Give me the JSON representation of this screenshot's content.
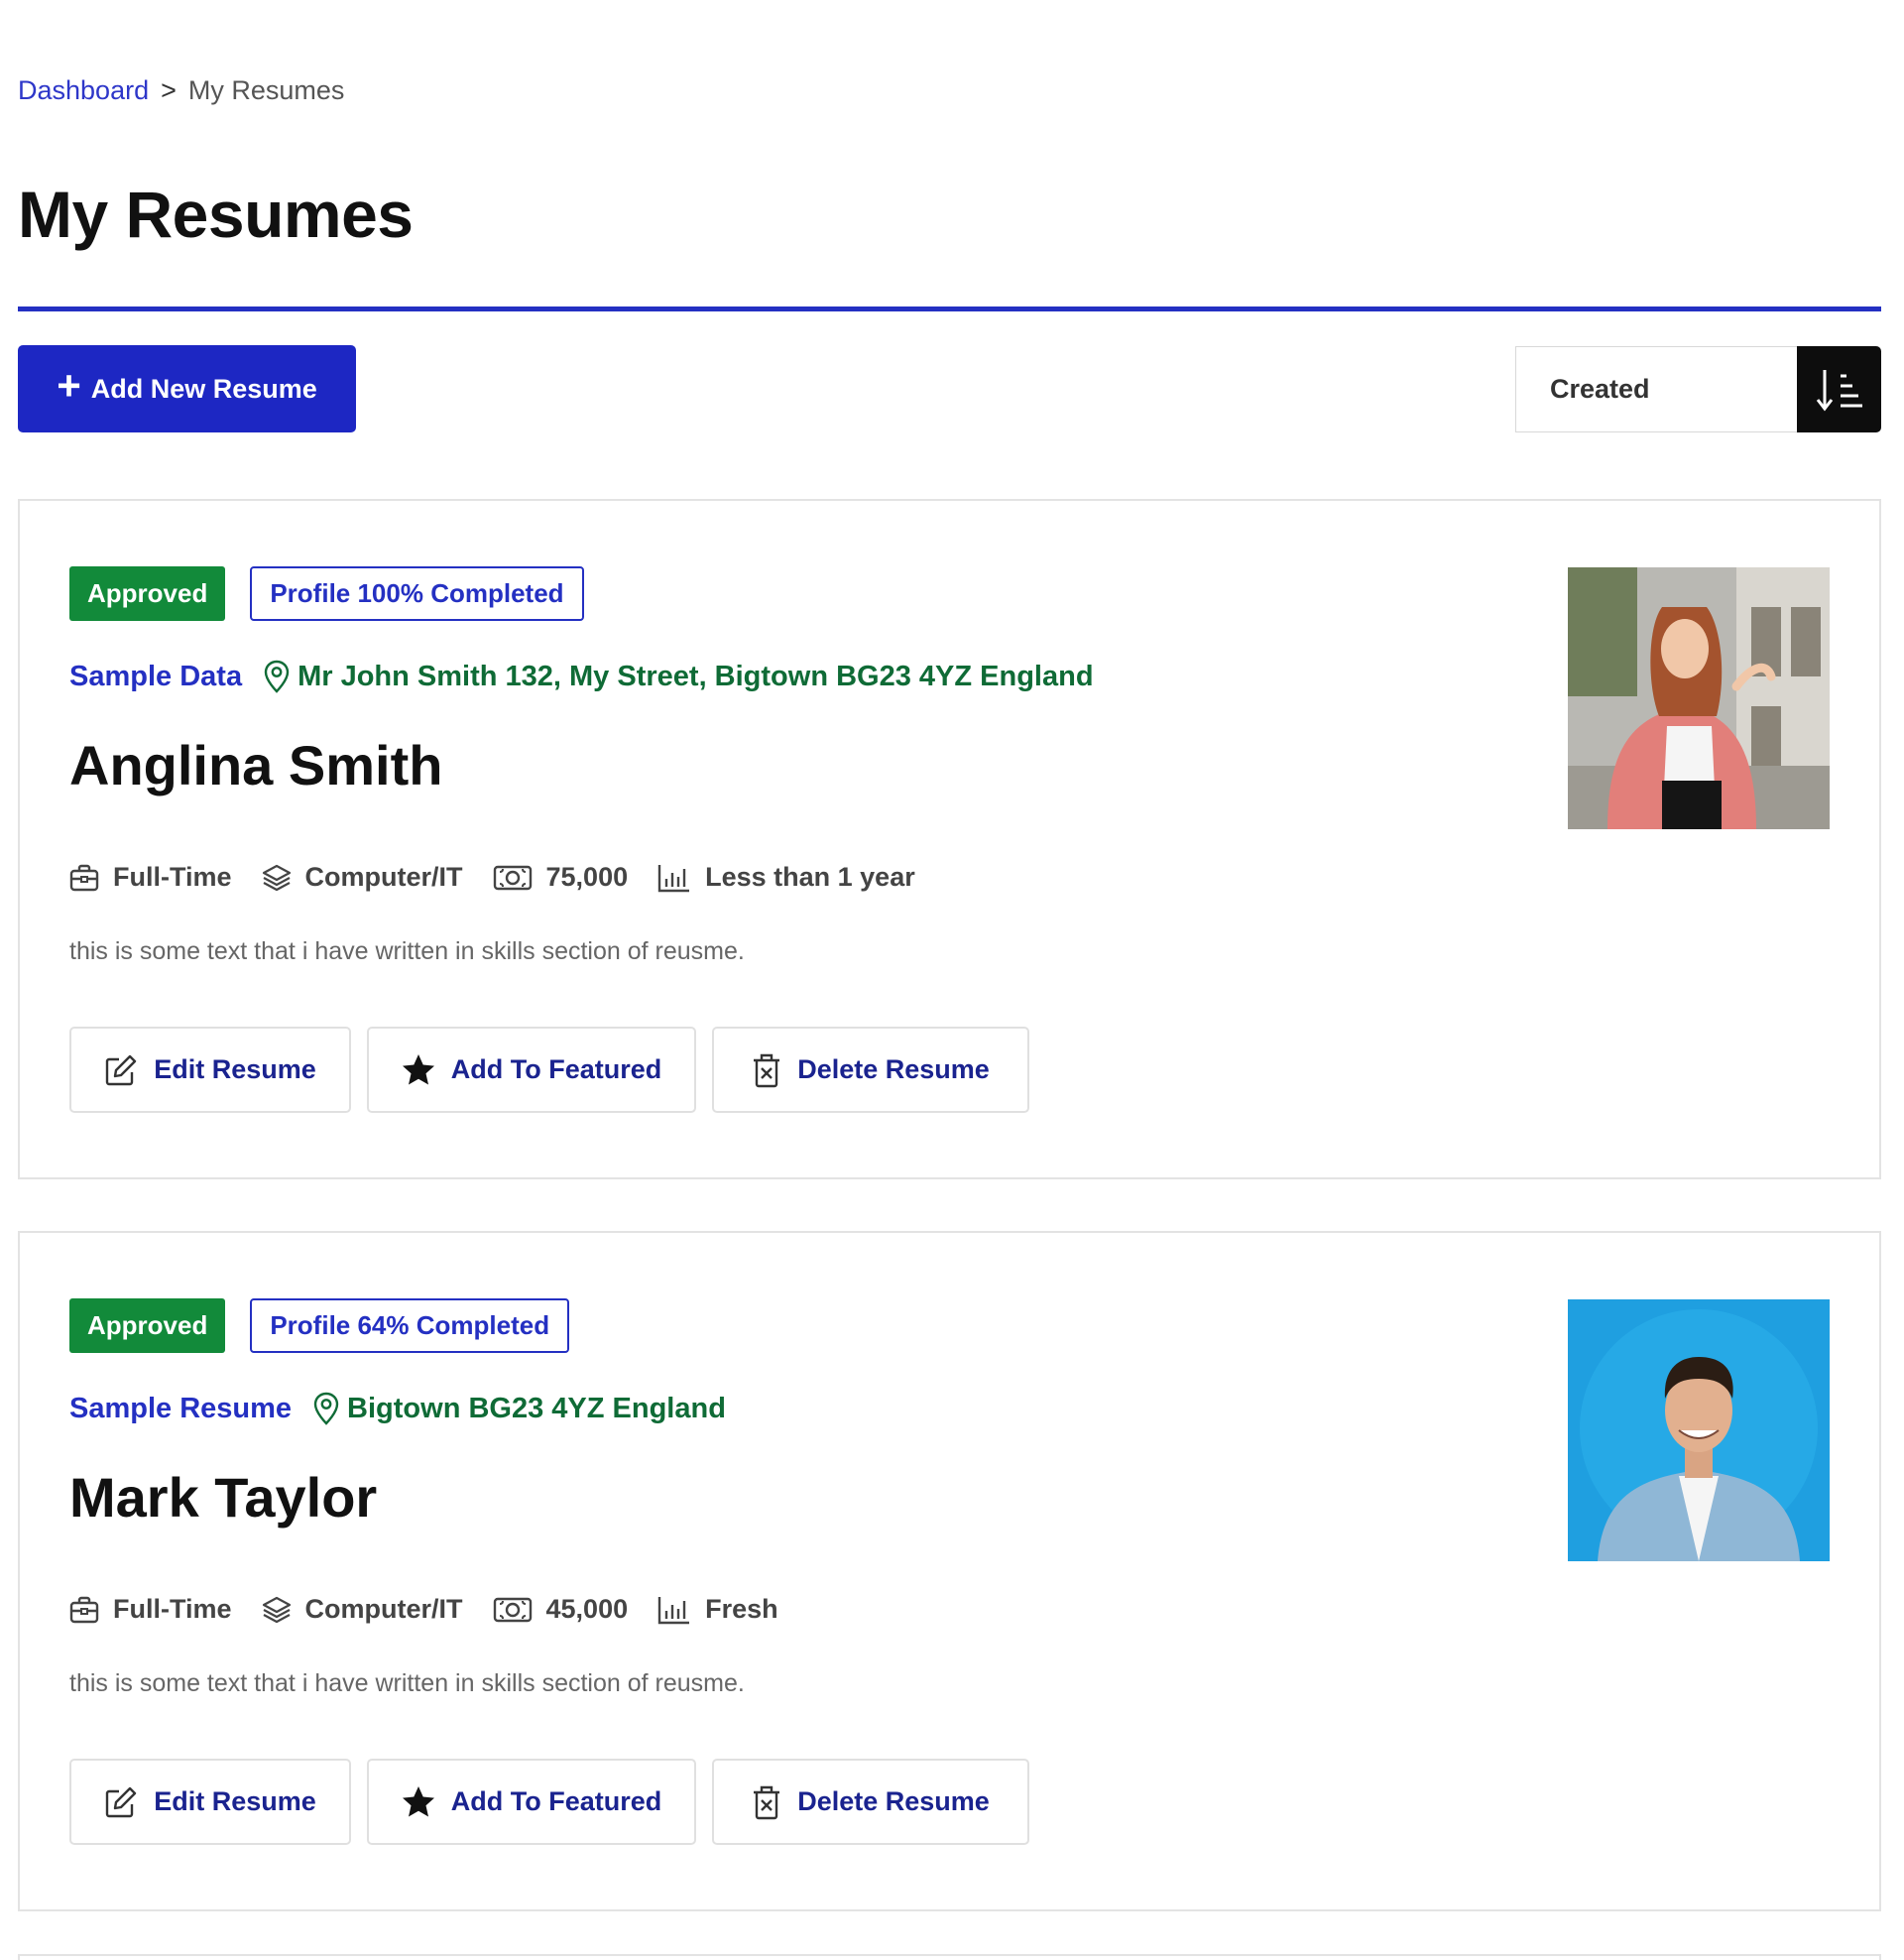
{
  "breadcrumb": {
    "dashboard_label": "Dashboard",
    "separator": ">",
    "current_label": "My Resumes"
  },
  "page": {
    "title": "My Resumes"
  },
  "toolbar": {
    "add_label": "Add New Resume",
    "sort_value": "Created",
    "sort_icon": "sort-ascending-icon"
  },
  "colors": {
    "primary": "#1d27c3",
    "approved_green": "#128a3a",
    "location_green": "#0f6b36",
    "sort_button": "#0d0d0d"
  },
  "resumes": [
    {
      "status": "Approved",
      "completion_label": "Profile 100% Completed",
      "completion_percent": 100,
      "title": "Sample Data",
      "location": "Mr John Smith 132, My Street, Bigtown BG23 4YZ England",
      "name": "Anglina Smith",
      "job_type": "Full-Time",
      "category": "Computer/IT",
      "salary": "75,000",
      "experience": "Less than 1 year",
      "description": "this is some text that i have written in skills section of reusme.",
      "actions": {
        "edit": "Edit Resume",
        "feature": "Add To Featured",
        "delete": "Delete Resume"
      }
    },
    {
      "status": "Approved",
      "completion_label": "Profile 64% Completed",
      "completion_percent": 64,
      "title": "Sample Resume",
      "location": "Bigtown BG23 4YZ England",
      "name": "Mark Taylor",
      "job_type": "Full-Time",
      "category": "Computer/IT",
      "salary": "45,000",
      "experience": "Fresh",
      "description": "this is some text that i have written in skills section of reusme.",
      "actions": {
        "edit": "Edit Resume",
        "feature": "Add To Featured",
        "delete": "Delete Resume"
      }
    }
  ]
}
